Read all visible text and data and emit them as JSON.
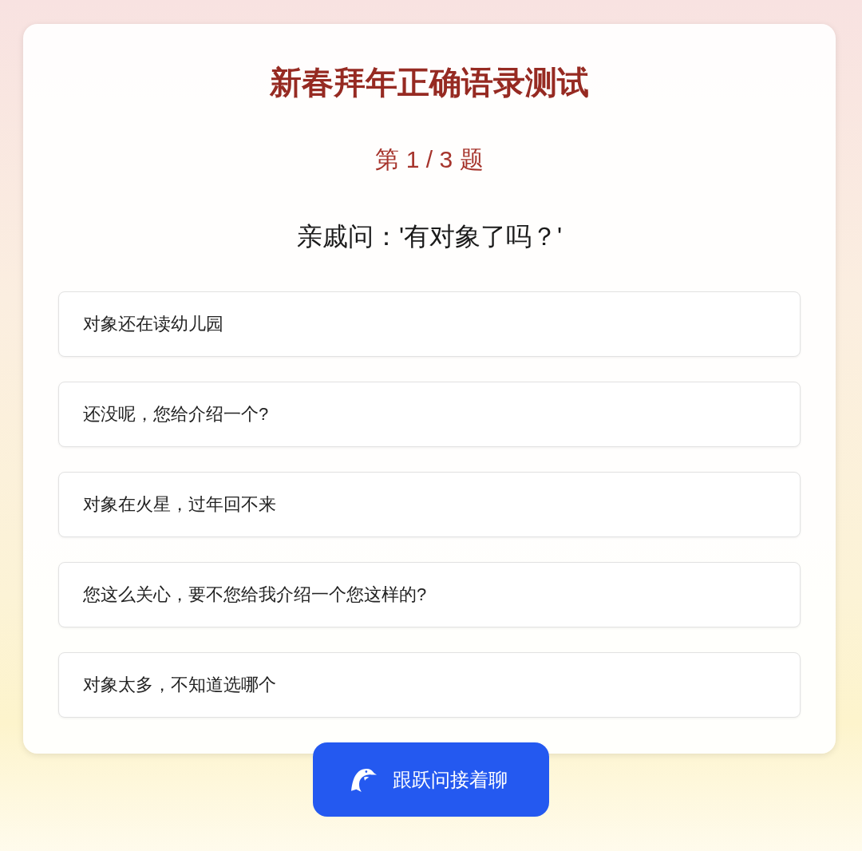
{
  "title": "新春拜年正确语录测试",
  "progress": "第 1 / 3 题",
  "question": "亲戚问：'有对象了吗？'",
  "options": [
    {
      "label": "对象还在读幼儿园",
      "selected": false
    },
    {
      "label": "还没呢，您给介绍一个?",
      "selected": false
    },
    {
      "label": "对象在火星，过年回不来",
      "selected": false
    },
    {
      "label": "您这么关心，要不您给我介绍一个您这样的?",
      "selected": false
    },
    {
      "label": "对象太多，不知道选哪个",
      "selected": false
    }
  ],
  "chat_button": {
    "label": "跟跃问接着聊"
  }
}
